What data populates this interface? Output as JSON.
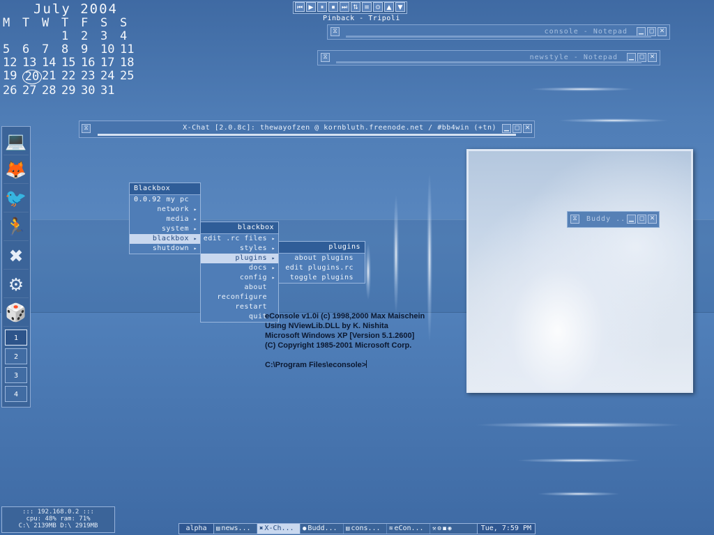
{
  "calendar": {
    "title": "July 2004",
    "weekdays": [
      "M",
      "T",
      "W",
      "T",
      "F",
      "S",
      "S"
    ],
    "days": [
      "",
      "",
      "",
      "1",
      "2",
      "3",
      "4",
      "5",
      "6",
      "7",
      "8",
      "9",
      "10",
      "11",
      "12",
      "13",
      "14",
      "15",
      "16",
      "17",
      "18",
      "19",
      "20",
      "21",
      "22",
      "23",
      "24",
      "25",
      "26",
      "27",
      "28",
      "29",
      "30",
      "31",
      ""
    ],
    "today": "20"
  },
  "media_bar": {
    "buttons": [
      "⏮",
      "▶",
      "⏸",
      "⏹",
      "⏭",
      "⇅",
      "≡",
      "⊙",
      "▲",
      "▼"
    ],
    "now_playing": "Pinback - Tripoli"
  },
  "windows": {
    "console_notepad": "console - Notepad",
    "newstyle_notepad": "newstyle - Notepad",
    "xchat_title": "X-Chat [2.0.8c]: thewayofzen @ kornbluth.freenode.net / #bb4win (+tn)",
    "buddy_title": "Buddy ..."
  },
  "dock": {
    "icons": [
      "my-computer-icon",
      "firefox-icon",
      "thunderbird-icon",
      "aim-icon",
      "xchat-icon",
      "settings-gears-icon",
      "dice-game-icon"
    ],
    "glyphs": [
      "💻",
      "🦊",
      "🐦",
      "🏃",
      "✖",
      "⚙",
      "🎲"
    ],
    "workspaces": [
      "1",
      "2",
      "3",
      "4"
    ],
    "active_workspace": "1"
  },
  "root_menu": {
    "title": "Blackbox 0.0.92",
    "items": [
      {
        "label": "my pc",
        "sub": false
      },
      {
        "label": "network",
        "sub": true
      },
      {
        "label": "media",
        "sub": true
      },
      {
        "label": "system",
        "sub": true
      },
      {
        "label": "blackbox",
        "sub": true
      },
      {
        "label": "shutdown",
        "sub": true
      }
    ]
  },
  "blackbox_menu": {
    "title": "blackbox",
    "items": [
      {
        "label": "edit .rc files",
        "sub": true
      },
      {
        "label": "styles",
        "sub": true
      },
      {
        "label": "plugins",
        "sub": true
      },
      {
        "label": "docs",
        "sub": true
      },
      {
        "label": "config",
        "sub": true
      },
      {
        "label": "about",
        "sub": false
      },
      {
        "label": "reconfigure",
        "sub": false
      },
      {
        "label": "restart",
        "sub": false
      },
      {
        "label": "quit",
        "sub": false
      }
    ]
  },
  "plugins_menu": {
    "title": "plugins",
    "items": [
      {
        "label": "about plugins"
      },
      {
        "label": "edit plugins.rc"
      },
      {
        "label": "toggle plugins"
      }
    ]
  },
  "console": {
    "lines": [
      "eConsole v1.0i (c) 1998,2000 Max Maischein",
      "Using NViewLib.DLL by K. Nishita",
      "Microsoft Windows XP [Version 5.1.2600]",
      "(C) Copyright 1985-2001 Microsoft Corp.",
      "",
      "C:\\Program Files\\econsole>"
    ]
  },
  "sysmon": {
    "ip": "::: 192.168.0.2 :::",
    "cpu_ram": "cpu: 48%    ram: 71%",
    "drives": "C:\\ 2139MB   D:\\ 2919MB"
  },
  "taskbar": {
    "workspace": "alpha",
    "tasks": [
      {
        "label": "news...",
        "icon": "▤",
        "active": false
      },
      {
        "label": "X-Ch...",
        "icon": "✖",
        "active": true
      },
      {
        "label": "Budd...",
        "icon": "●",
        "active": false
      },
      {
        "label": "cons...",
        "icon": "▤",
        "active": false
      },
      {
        "label": "eCon...",
        "icon": "≋",
        "active": false
      }
    ],
    "tray": [
      "⚒",
      "⚙",
      "◼",
      "◉"
    ],
    "clock": "Tue, 7:59 PM"
  }
}
